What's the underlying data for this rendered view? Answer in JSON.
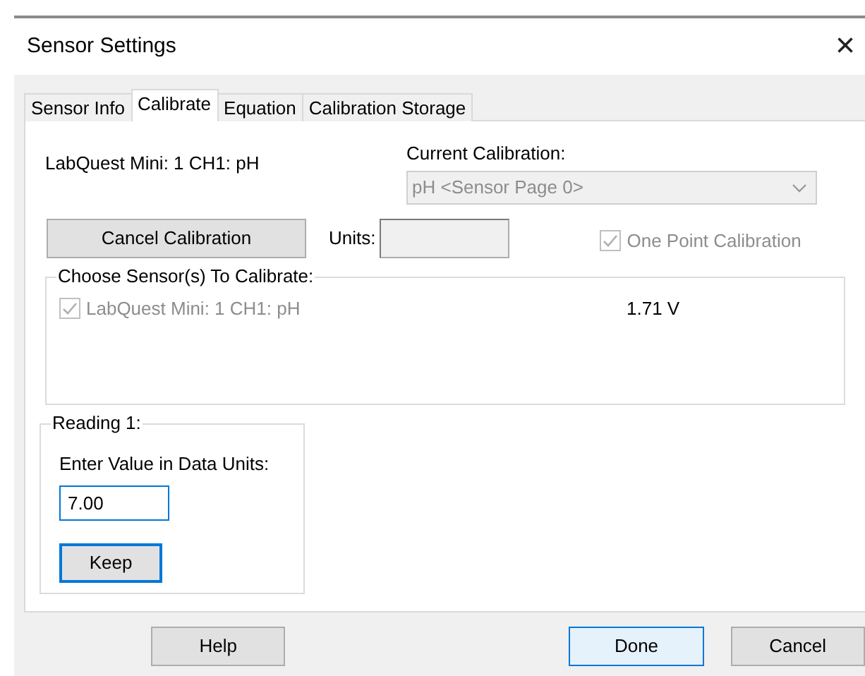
{
  "window": {
    "title": "Sensor Settings",
    "close": "×"
  },
  "tabs": [
    {
      "label": "Sensor Info",
      "selected": false
    },
    {
      "label": "Calibrate",
      "selected": true
    },
    {
      "label": "Equation",
      "selected": false
    },
    {
      "label": "Calibration Storage",
      "selected": false
    }
  ],
  "device_label": "LabQuest Mini: 1 CH1: pH",
  "current_calibration": {
    "label": "Current Calibration:",
    "value": "pH <Sensor Page 0>",
    "disabled": true
  },
  "cancel_calibration_button": {
    "label": "Cancel Calibration"
  },
  "units": {
    "label": "Units:",
    "disabled": true
  },
  "one_point_calibration": {
    "label": "One Point Calibration",
    "checked": true,
    "disabled": true
  },
  "sensor_group": {
    "title": "Choose Sensor(s) To Calibrate:",
    "sensors": [
      {
        "label": "LabQuest Mini: 1 CH1: pH",
        "checked": true,
        "disabled": true,
        "reading": "1.71 V"
      }
    ]
  },
  "reading_group": {
    "title": "Reading 1:",
    "prompt": "Enter Value in Data Units:",
    "value": "7.00",
    "keep_button": {
      "label": "Keep",
      "default": true
    }
  },
  "footer_buttons": [
    {
      "label": "Help",
      "default": false
    },
    {
      "label": "Done",
      "default": true
    },
    {
      "label": "Cancel",
      "default": false
    }
  ]
}
